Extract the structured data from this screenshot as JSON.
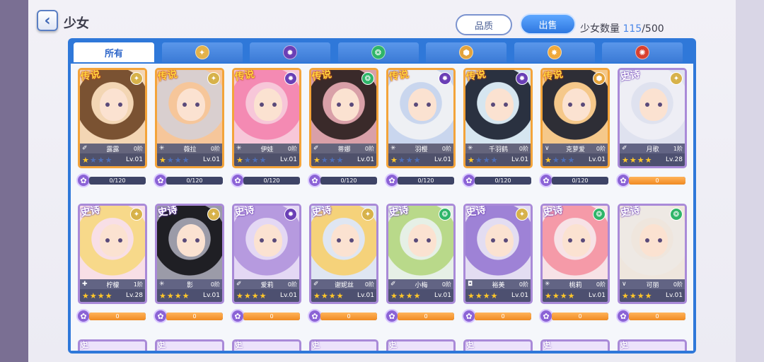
{
  "header": {
    "back_icon": "‹",
    "title": "少女",
    "quality_button": "品质",
    "sell_button": "出售",
    "count_label": "少女数量",
    "count_current": "115",
    "count_sep": "/",
    "count_max": "500"
  },
  "tabs": [
    {
      "label": "所有",
      "icon": "all"
    },
    {
      "label": "",
      "icon": "wings-emblem",
      "color": "#e3b24a"
    },
    {
      "label": "",
      "icon": "dark-emblem",
      "color": "#6a3fb6"
    },
    {
      "label": "",
      "icon": "wind-emblem",
      "color": "#2fb569"
    },
    {
      "label": "",
      "icon": "shield-emblem",
      "color": "#e3a33a"
    },
    {
      "label": "",
      "icon": "sun-emblem",
      "color": "#f0a93b"
    },
    {
      "label": "",
      "icon": "fire-emblem",
      "color": "#d8402e"
    }
  ],
  "cards": [
    {
      "rarity": "传说",
      "tier": "legend",
      "element": "light",
      "elem_color": "#d7b24a",
      "class_icon": "✐",
      "name": "露露",
      "rank": "0阶",
      "stars": 1,
      "level": "Lv.01",
      "progress": "0/120",
      "fill": 0,
      "hair": "#7a5232",
      "bg": "#f3d6b4"
    },
    {
      "rarity": "传说",
      "tier": "legend",
      "element": "light",
      "elem_color": "#d7b24a",
      "class_icon": "✳",
      "name": "薇拉",
      "rank": "0阶",
      "stars": 1,
      "level": "Lv.01",
      "progress": "0/120",
      "fill": 0,
      "hair": "#d9cfcf",
      "bg": "#f6c69a"
    },
    {
      "rarity": "传说",
      "tier": "legend",
      "element": "dark",
      "elem_color": "#6a3fb6",
      "class_icon": "✳",
      "name": "伊娃",
      "rank": "0阶",
      "stars": 1,
      "level": "Lv.01",
      "progress": "0/120",
      "fill": 0,
      "hair": "#f48ab3",
      "bg": "#f7c7d9"
    },
    {
      "rarity": "传说",
      "tier": "legend",
      "element": "wind",
      "elem_color": "#2fb569",
      "class_icon": "✐",
      "name": "蒂娜",
      "rank": "0阶",
      "stars": 1,
      "level": "Lv.01",
      "progress": "0/120",
      "fill": 0,
      "hair": "#3a2a2a",
      "bg": "#d9a0a8"
    },
    {
      "rarity": "传说",
      "tier": "legend",
      "element": "dark",
      "elem_color": "#6a3fb6",
      "class_icon": "✳",
      "name": "羽樱",
      "rank": "0阶",
      "stars": 1,
      "level": "Lv.01",
      "progress": "0/120",
      "fill": 0,
      "hair": "#eef0f4",
      "bg": "#c9d6ee"
    },
    {
      "rarity": "传说",
      "tier": "legend",
      "element": "dark",
      "elem_color": "#6a3fb6",
      "class_icon": "✳",
      "name": "千羽鹤",
      "rank": "0阶",
      "stars": 1,
      "level": "Lv.01",
      "progress": "0/120",
      "fill": 0,
      "hair": "#2a3140",
      "bg": "#d6e6f0"
    },
    {
      "rarity": "传说",
      "tier": "legend",
      "element": "shield",
      "elem_color": "#e3a33a",
      "class_icon": "∨",
      "name": "克萝爱",
      "rank": "0阶",
      "stars": 1,
      "level": "Lv.01",
      "progress": "0/120",
      "fill": 0,
      "hair": "#2e2e36",
      "bg": "#f5c88a"
    },
    {
      "rarity": "史诗",
      "tier": "epic",
      "element": "light",
      "elem_color": "#d7b24a",
      "class_icon": "✐",
      "name": "月歌",
      "rank": "1阶",
      "stars": 4,
      "level": "Lv.28",
      "progress": "0",
      "fill": 1,
      "hair": "#eeeef5",
      "bg": "#dfe2ef"
    },
    {
      "rarity": "史诗",
      "tier": "epic",
      "element": "light",
      "elem_color": "#d7b24a",
      "class_icon": "✚",
      "name": "柠檬",
      "rank": "1阶",
      "stars": 4,
      "level": "Lv.28",
      "progress": "0",
      "fill": 1,
      "hair": "#f7d98a",
      "bg": "#f8dfe6"
    },
    {
      "rarity": "史诗",
      "tier": "epic",
      "element": "light",
      "elem_color": "#d7b24a",
      "class_icon": "✳",
      "name": "影",
      "rank": "0阶",
      "stars": 4,
      "level": "Lv.01",
      "progress": "0",
      "fill": 1,
      "hair": "#1f1f24",
      "bg": "#9b9ba8"
    },
    {
      "rarity": "史诗",
      "tier": "epic",
      "element": "dark",
      "elem_color": "#6a3fb6",
      "class_icon": "✐",
      "name": "爱莉",
      "rank": "0阶",
      "stars": 4,
      "level": "Lv.01",
      "progress": "0",
      "fill": 1,
      "hair": "#b69adf",
      "bg": "#e4d8f4"
    },
    {
      "rarity": "史诗",
      "tier": "epic",
      "element": "light",
      "elem_color": "#d7b24a",
      "class_icon": "✐",
      "name": "谢妮丝",
      "rank": "0阶",
      "stars": 4,
      "level": "Lv.01",
      "progress": "0",
      "fill": 1,
      "hair": "#f5d27a",
      "bg": "#dfe6f2"
    },
    {
      "rarity": "史诗",
      "tier": "epic",
      "element": "wind",
      "elem_color": "#2fb569",
      "class_icon": "✐",
      "name": "小梅",
      "rank": "0阶",
      "stars": 4,
      "level": "Lv.01",
      "progress": "0",
      "fill": 1,
      "hair": "#b9d98a",
      "bg": "#e6f0e6"
    },
    {
      "rarity": "史诗",
      "tier": "epic",
      "element": "light",
      "elem_color": "#d7b24a",
      "class_icon": "◘",
      "name": "裕美",
      "rank": "0阶",
      "stars": 4,
      "level": "Lv.01",
      "progress": "0",
      "fill": 1,
      "hair": "#9e82d6",
      "bg": "#e3ddf2"
    },
    {
      "rarity": "史诗",
      "tier": "epic",
      "element": "wind",
      "elem_color": "#2fb569",
      "class_icon": "✳",
      "name": "桃莉",
      "rank": "0阶",
      "stars": 4,
      "level": "Lv.01",
      "progress": "0",
      "fill": 1,
      "hair": "#f59aa8",
      "bg": "#f7e2e6"
    },
    {
      "rarity": "史诗",
      "tier": "epic",
      "element": "wind",
      "elem_color": "#2fb569",
      "class_icon": "∨",
      "name": "可丽",
      "rank": "0阶",
      "stars": 4,
      "level": "Lv.01",
      "progress": "0",
      "fill": 1,
      "hair": "#eee9e4",
      "bg": "#efe6dd"
    }
  ],
  "peek_rarity": "史"
}
